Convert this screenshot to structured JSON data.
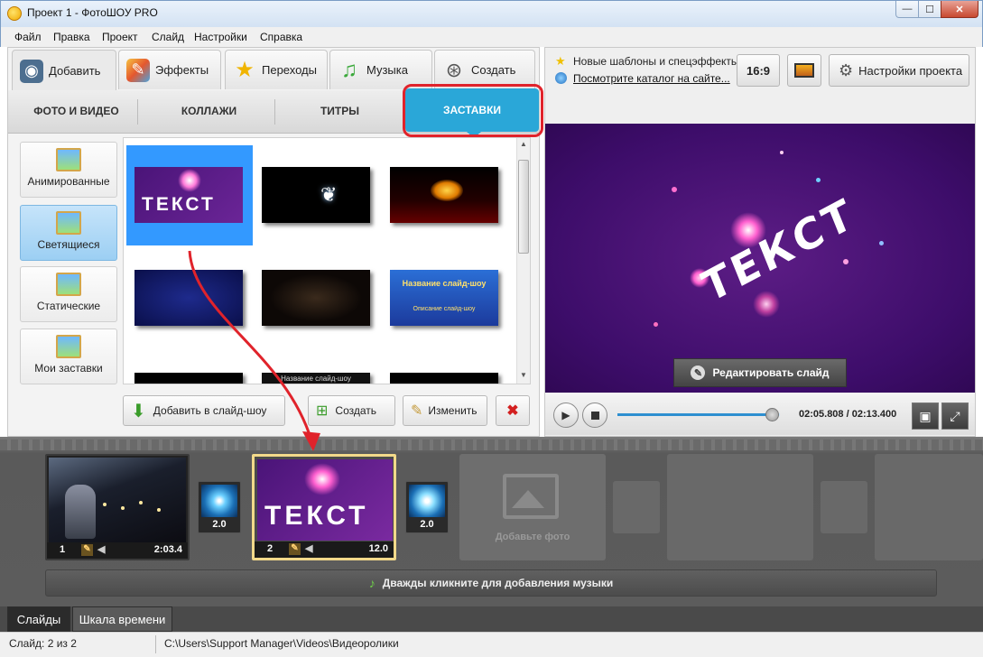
{
  "window": {
    "title": "Проект 1 - ФотоШОУ PRO",
    "min": "—",
    "max": "☐",
    "close": "✕"
  },
  "menu": [
    "Файл",
    "Правка",
    "Проект",
    "Слайд",
    "Настройки",
    "Справка"
  ],
  "main_tabs": [
    {
      "label": "Добавить",
      "icon": "camera-icon"
    },
    {
      "label": "Эффекты",
      "icon": "palette-icon"
    },
    {
      "label": "Переходы",
      "icon": "star-icon"
    },
    {
      "label": "Музыка",
      "icon": "music-note-icon"
    },
    {
      "label": "Создать",
      "icon": "film-reel-icon"
    }
  ],
  "sub_tabs": [
    "ФОТО И ВИДЕО",
    "КОЛЛАЖИ",
    "ТИТРЫ",
    "ЗАСТАВКИ"
  ],
  "categories": [
    "Анимированные",
    "Светящиеся",
    "Статические",
    "Мои заставки"
  ],
  "thumbs": {
    "t1": "ТЕКСТ",
    "t6": "Название слайд-шоу",
    "t6b": "Описание слайд-шоу",
    "t8": "Название слайд-шоу"
  },
  "actions": {
    "add": "Добавить в слайд-шоу",
    "create": "Создать",
    "edit": "Изменить"
  },
  "right": {
    "news1": "Новые шаблоны и спецэффекты",
    "news2": "Посмотрите каталог на сайте...",
    "ratio": "16:9",
    "settings": "Настройки проекта",
    "preview_text": "ТЕКСТ",
    "edit_slide": "Редактировать слайд",
    "time": "02:05.808 / 02:13.400",
    "progress": 0.95
  },
  "timeline": {
    "slide1": {
      "num": "1",
      "dur": "2:03.4"
    },
    "trans1": "2.0",
    "slide2": {
      "num": "2",
      "dur": "12.0",
      "text": "ТЕКСТ"
    },
    "trans2": "2.0",
    "add_photo": "Добавьте фото",
    "music": "Дважды кликните для добавления музыки"
  },
  "bottom_tabs": [
    "Слайды",
    "Шкала времени"
  ],
  "status": {
    "slide": "Слайд: 2 из 2",
    "path": "C:\\Users\\Support Manager\\Videos\\Видеоролики"
  },
  "colors": {
    "accent": "#2aa7d8",
    "highlight": "#e0232b",
    "selected_slide": "#f2d98a",
    "arrow": "#e0232b"
  }
}
